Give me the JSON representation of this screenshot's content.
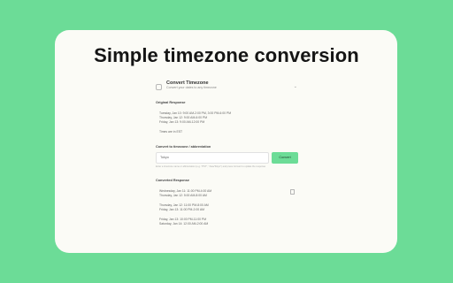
{
  "headline": "Simple timezone conversion",
  "panel": {
    "app_title": "Convert Timezone",
    "app_subtitle": "Convert your dates to any timezone",
    "collapse_glyph": "⌄",
    "original_section_title": "Original Response",
    "original_lines": [
      "Tuesday, Jan 10: 9:00 AM-2:00 PM, 3:00 PM-6:00 PM",
      "Thursday, Jan 12: 9:00 AM-6:00 PM",
      "Friday, Jan 13: 9:00 AM-12:00 PM"
    ],
    "times_note": "Times are in EST",
    "convert_section_title": "Convert to timezone / abbreviation",
    "timezone_input_value": "Tokyo",
    "convert_button_label": "Convert",
    "hint": "Enter a timezone name or abbreviation (e.g. \"PST\", \"Asia/Tokyo\") and press Convert to update the response",
    "converted_section_title": "Converted Response",
    "converted_lines": [
      "Wednesday, Jan 11: 11:00 PM-4:00 AM",
      "Thursday, Jan 12: 5:00 AM-8:00 AM",
      "Thursday, Jan 12: 11:00 PM-8:00 AM",
      "Friday, Jan 13: 11:00 PM-2:00 AM",
      "Friday, Jan 13: 10:00 PM-11:00 PM",
      "Saturday, Jan 14: 12:00 AM-2:00 AM"
    ],
    "icons": {
      "app": "calendar-icon",
      "collapse": "chevron-down-icon",
      "copy": "copy-icon"
    }
  }
}
